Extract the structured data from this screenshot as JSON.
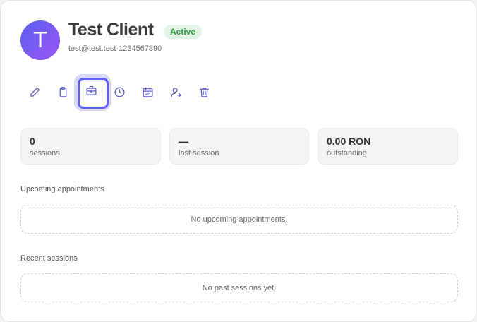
{
  "client": {
    "initial": "T",
    "name": "Test Client",
    "status": "Active",
    "email": "test@test.test",
    "separator": "·",
    "phone": "1234567890"
  },
  "toolbar": {
    "items": [
      {
        "icon": "pencil-icon",
        "label": "Edit"
      },
      {
        "icon": "clipboard-icon",
        "label": "Notes"
      },
      {
        "icon": "briefcase-icon",
        "label": "Cases",
        "active": true
      },
      {
        "icon": "clock-icon",
        "label": "History"
      },
      {
        "icon": "calendar-icon",
        "label": "Schedule"
      },
      {
        "icon": "user-arrow-icon",
        "label": "Transfer"
      },
      {
        "icon": "trash-icon",
        "label": "Delete"
      }
    ]
  },
  "stats": [
    {
      "value": "0",
      "label": "sessions"
    },
    {
      "value": "—",
      "label": "last session"
    },
    {
      "value": "0.00 RON",
      "label": "outstanding"
    }
  ],
  "upcoming": {
    "title": "Upcoming appointments",
    "empty": "No upcoming appointments."
  },
  "recent": {
    "title": "Recent sessions",
    "empty": "No past sessions yet."
  },
  "colors": {
    "accent": "#5d5ff0",
    "icon": "#5b5fc7",
    "badge_bg": "#e3f5e6",
    "badge_text": "#2d9a48"
  }
}
